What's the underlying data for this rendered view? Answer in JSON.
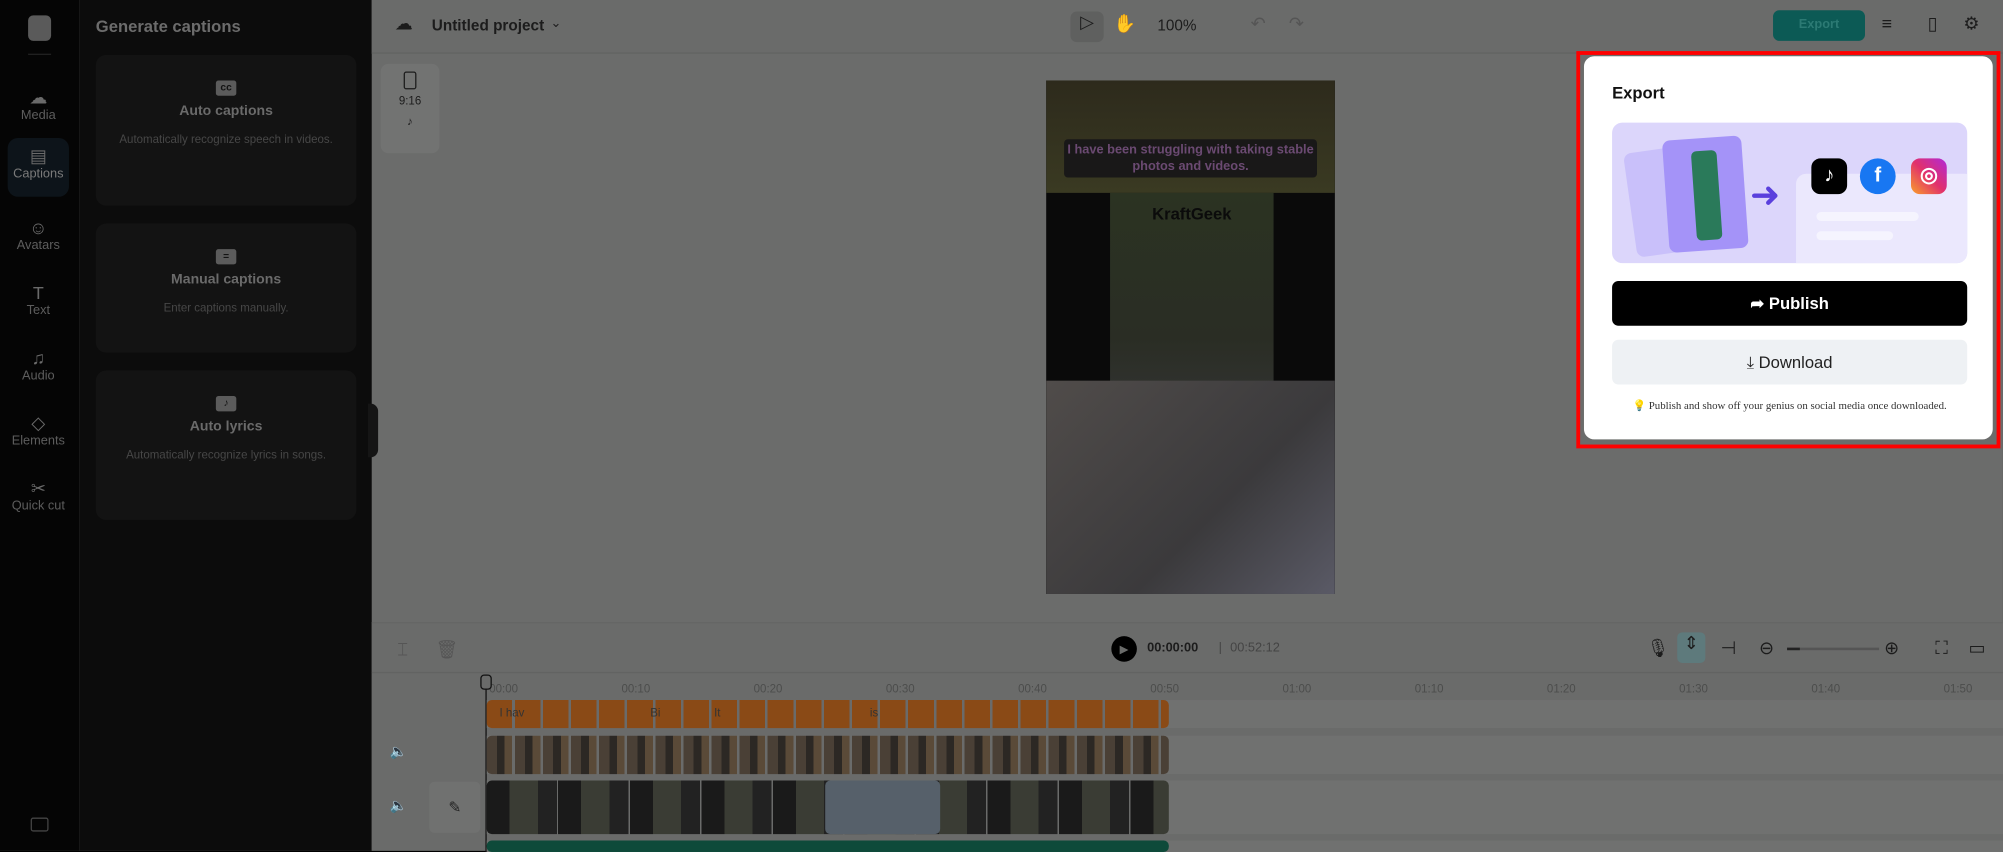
{
  "rail": {
    "items": [
      {
        "label": "Media",
        "icon": "☁"
      },
      {
        "label": "Captions",
        "icon": "▤"
      },
      {
        "label": "Avatars",
        "icon": "☺"
      },
      {
        "label": "Text",
        "icon": "T"
      },
      {
        "label": "Audio",
        "icon": "♫"
      },
      {
        "label": "Elements",
        "icon": "◇"
      },
      {
        "label": "Quick cut",
        "icon": "✂"
      }
    ]
  },
  "panel": {
    "title": "Generate captions",
    "cards": [
      {
        "title": "Auto captions",
        "desc": "Automatically recognize speech in videos.",
        "icon": "cc"
      },
      {
        "title": "Manual captions",
        "desc": "Enter captions manually.",
        "icon": "="
      },
      {
        "title": "Auto lyrics",
        "desc": "Automatically recognize lyrics in songs.",
        "icon": "♪"
      }
    ]
  },
  "topbar": {
    "project": "Untitled project",
    "zoom": "100%",
    "export": "Export"
  },
  "ratio": {
    "label": "9:16"
  },
  "video": {
    "caption": "I have been struggling with taking stable photos and videos.",
    "brand": "KraftGeek"
  },
  "timeline": {
    "current": "00:00:00",
    "total": "00:52:12",
    "ticks": [
      "00:00",
      "00:10",
      "00:20",
      "00:30",
      "00:40",
      "00:50",
      "01:00",
      "01:10",
      "01:20",
      "01:30",
      "01:40",
      "01:50"
    ],
    "caption_clips": [
      "I hav",
      "Bi",
      "It",
      "is"
    ]
  },
  "export_panel": {
    "title": "Export",
    "publish": "Publish",
    "download": "Download",
    "tip": "Publish and show off your genius on social media once downloaded.",
    "accent": "#000000"
  }
}
